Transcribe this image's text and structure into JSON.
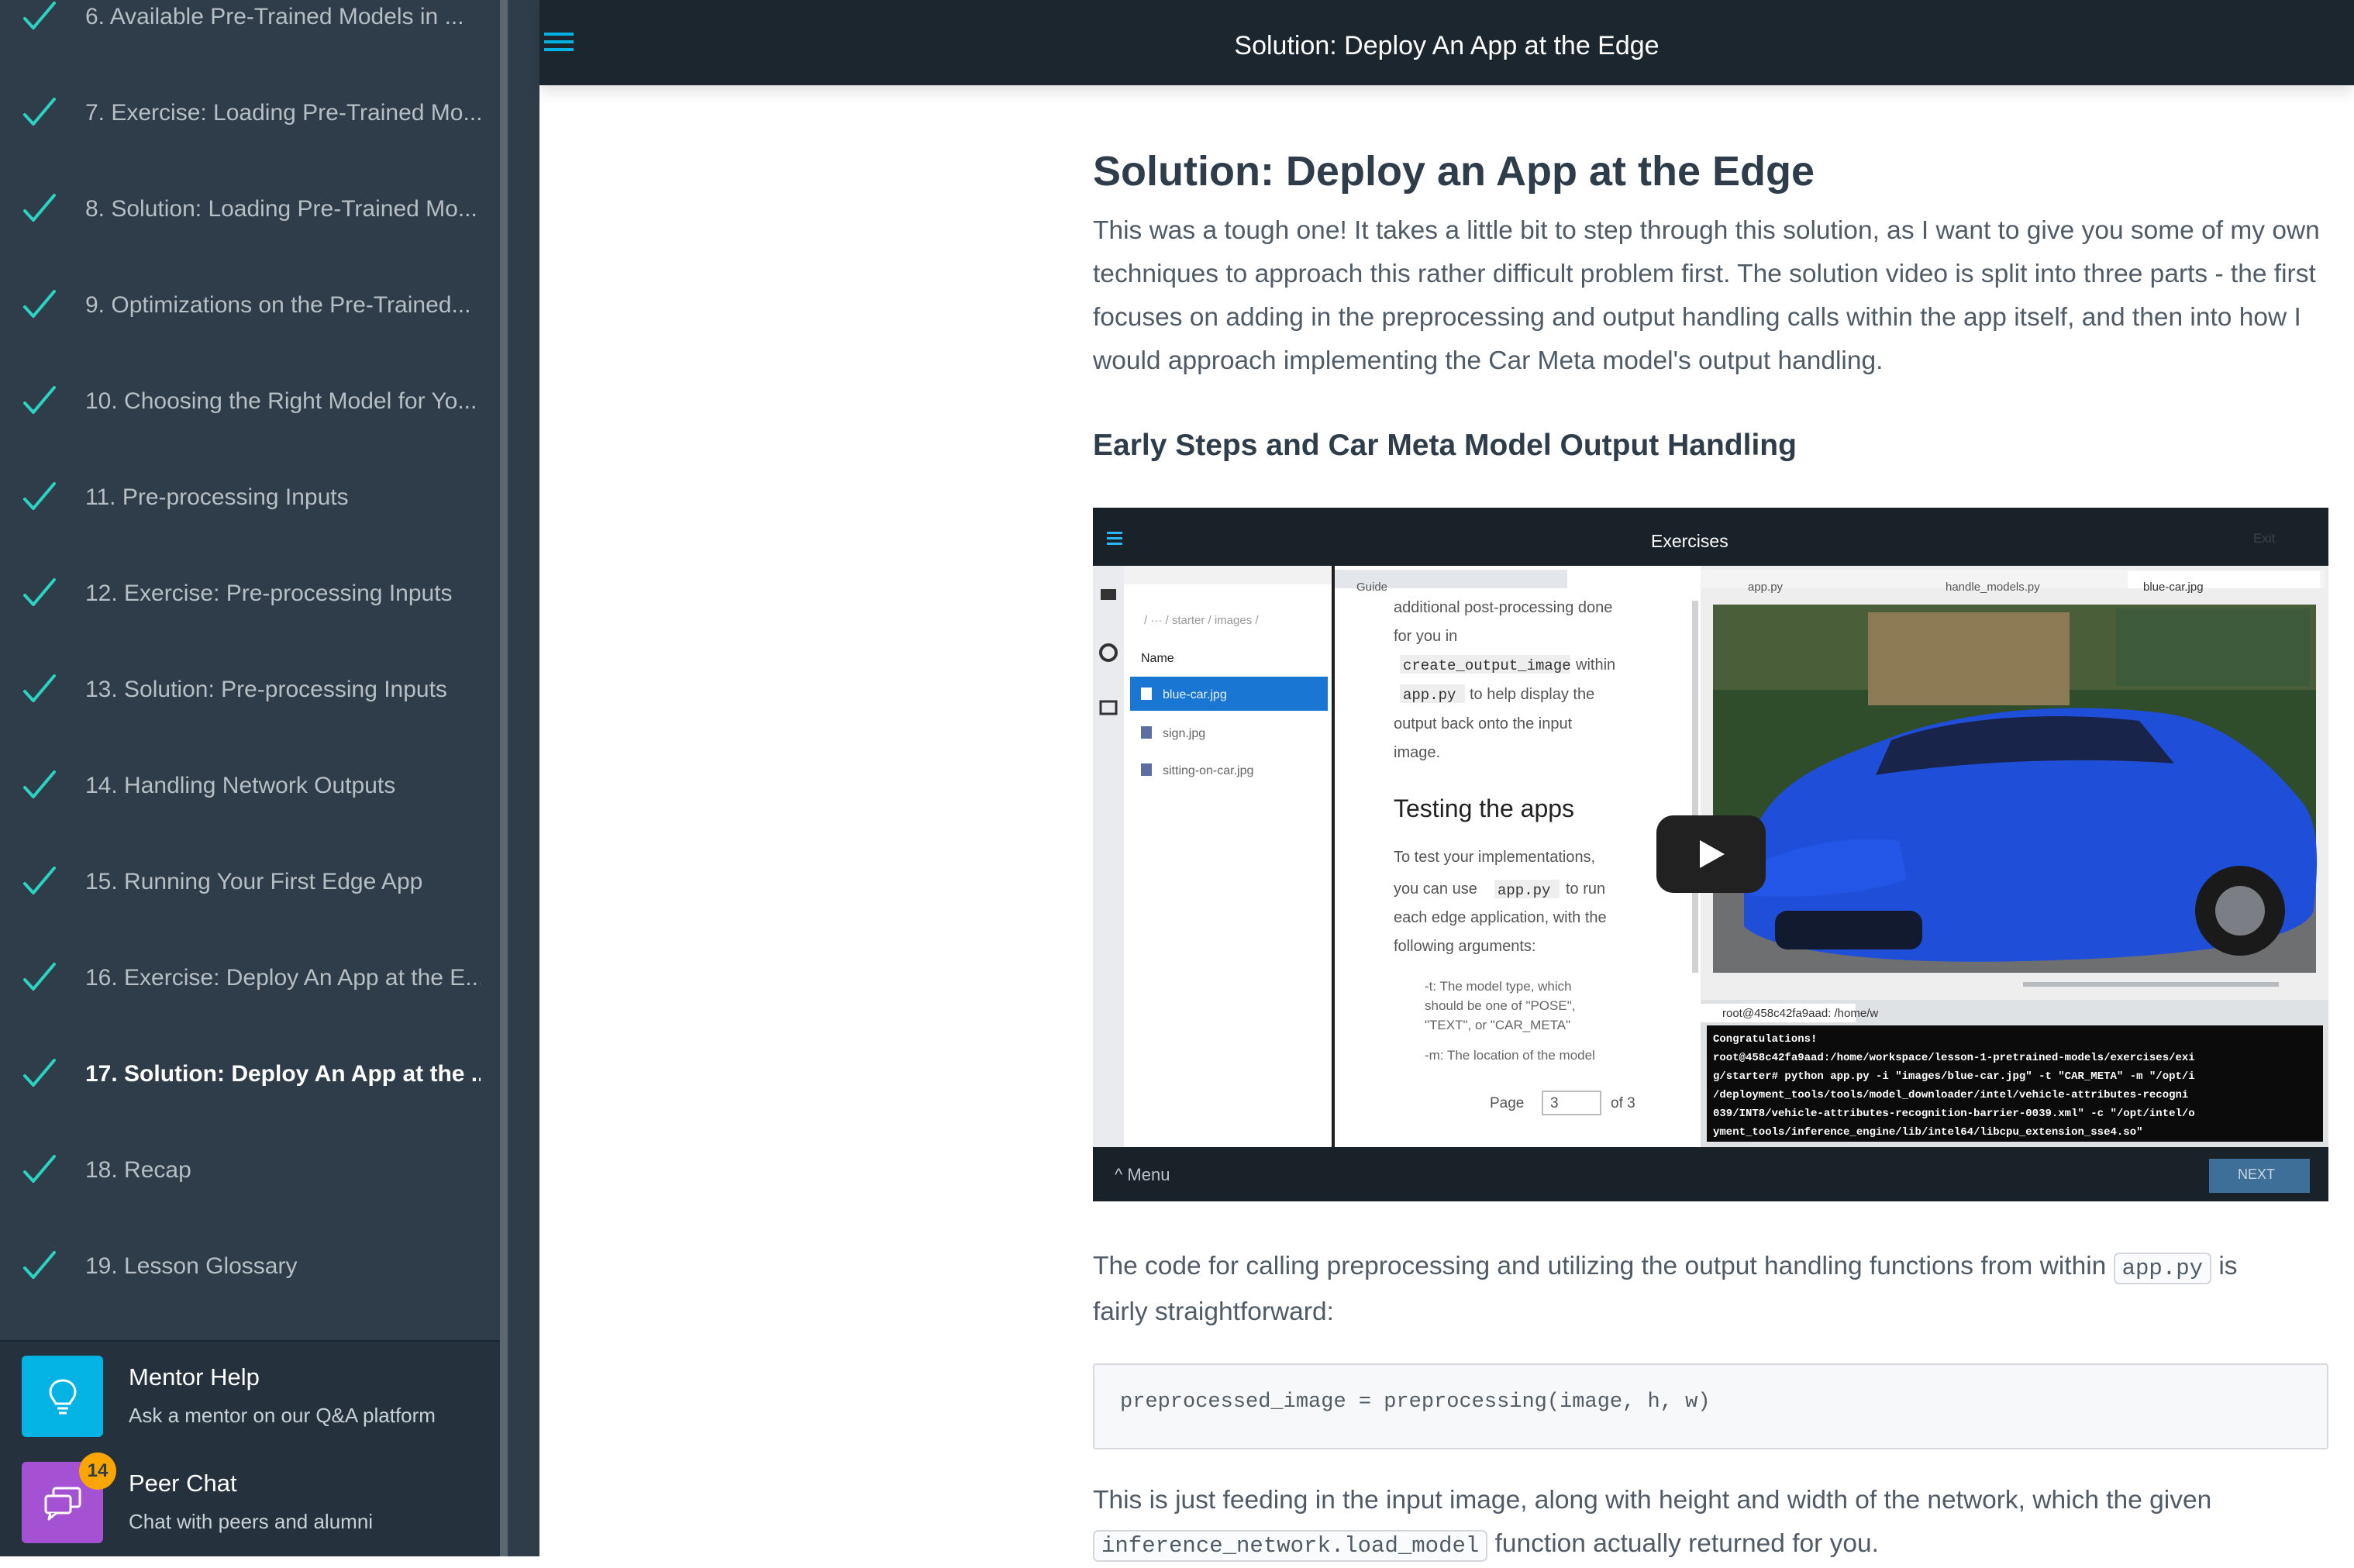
{
  "sidebar": {
    "lessons": [
      {
        "label": "6. Available Pre-Trained Models in ...",
        "completed": true
      },
      {
        "label": "7. Exercise: Loading Pre-Trained Mo...",
        "completed": true
      },
      {
        "label": "8. Solution: Loading Pre-Trained Mo...",
        "completed": true
      },
      {
        "label": "9. Optimizations on the Pre-Trained...",
        "completed": true
      },
      {
        "label": "10. Choosing the Right Model for Yo...",
        "completed": true
      },
      {
        "label": "11. Pre-processing Inputs",
        "completed": true
      },
      {
        "label": "12. Exercise: Pre-processing Inputs",
        "completed": true
      },
      {
        "label": "13. Solution: Pre-processing Inputs",
        "completed": true
      },
      {
        "label": "14. Handling Network Outputs",
        "completed": true
      },
      {
        "label": "15. Running Your First Edge App",
        "completed": true
      },
      {
        "label": "16. Exercise: Deploy An App at the E...",
        "completed": true
      },
      {
        "label": "17. Solution: Deploy An App at the ...",
        "completed": true,
        "active": true
      },
      {
        "label": "18. Recap",
        "completed": true
      },
      {
        "label": "19. Lesson Glossary",
        "completed": true
      }
    ],
    "mentor_help": {
      "title": "Mentor Help",
      "subtitle": "Ask a mentor on our Q&A platform",
      "color": "#02b3e4",
      "icon": "lightbulb-icon"
    },
    "peer_chat": {
      "title": "Peer Chat",
      "subtitle": "Chat with peers and alumni",
      "badge": "14",
      "color": "#a451d4",
      "icon": "chat-bubbles-icon"
    }
  },
  "header": {
    "title": "Solution: Deploy An App at the Edge",
    "menu_icon": "hamburger-menu-icon"
  },
  "content": {
    "title": "Solution: Deploy an App at the Edge",
    "intro": "This was a tough one! It takes a little bit to step through this solution, as I want to give you some of my own techniques to approach this rather difficult problem first. The solution video is split into three parts - the first focuses on adding in the preprocessing and output handling calls within the app itself, and then into how I would approach implementing the Car Meta model's output handling.",
    "section_heading": "Early Steps and Car Meta Model Output Handling",
    "video": {
      "title_bar": "Exercises",
      "exit": "Exit",
      "path": "/ ··· / starter / images /",
      "name_header": "Name",
      "files": [
        "blue-car.jpg",
        "sign.jpg",
        "sitting-on-car.jpg"
      ],
      "guide_tab": "Guide",
      "tabs": [
        "app.py",
        "handle_models.py",
        "blue-car.jpg"
      ],
      "guide_lines": [
        "additional post-processing done",
        "for you in"
      ],
      "guide_code1": "create_output_image",
      "guide_code1_after": "within",
      "guide_code2": "app.py",
      "guide_code2_after": "to help display the",
      "guide_lines2": [
        "output back onto the input",
        "image."
      ],
      "guide_heading": "Testing the apps",
      "guide_para": [
        "To test your implementations,",
        "you can use",
        "to run",
        "each edge application, with the",
        "following arguments:"
      ],
      "guide_code3": "app.py",
      "guide_bullets": [
        "-t: The model type, which",
        "should be one of \"POSE\",",
        "\"TEXT\", or \"CAR_META\"",
        "-m: The location of the model"
      ],
      "page_label": "Page",
      "page_value": "3",
      "page_of": "of 3",
      "terminal_tab": "root@458c42fa9aad: /home/w",
      "terminal_lines": [
        "Congratulations!",
        "root@458c42fa9aad:/home/workspace/lesson-1-pretrained-models/exercises/exi",
        "g/starter# python app.py -i \"images/blue-car.jpg\" -t \"CAR_META\" -m \"/opt/i",
        "/deployment_tools/tools/model_downloader/intel/vehicle-attributes-recogni",
        "039/INT8/vehicle-attributes-recognition-barrier-0039.xml\" -c \"/opt/intel/o",
        "yment_tools/inference_engine/lib/intel64/libcpu_extension_sse4.so\""
      ],
      "menu_label": "^ Menu",
      "next_label": "NEXT",
      "play_icon": "play-icon"
    },
    "para2_before": "The code for calling preprocessing and utilizing the output handling functions from within",
    "para2_code": "app.py",
    "para2_after": "is",
    "para2_line2": "fairly straightforward:",
    "code_block": "preprocessed_image = preprocessing(image, h, w)",
    "para3_line1": "This is just feeding in the input image, along with height and width of the network, which the given",
    "para3_code": "inference_network.load_model",
    "para3_after": "function actually returned for you."
  }
}
